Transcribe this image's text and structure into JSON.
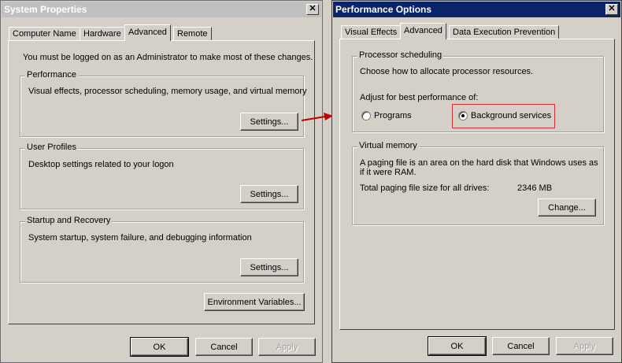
{
  "system_properties": {
    "title": "System Properties",
    "tabs": [
      "Computer Name",
      "Hardware",
      "Advanced",
      "Remote"
    ],
    "admin_note": "You must be logged on as an Administrator to make most of these changes.",
    "performance": {
      "legend": "Performance",
      "description": "Visual effects, processor scheduling, memory usage, and virtual memory",
      "settings_label": "Settings..."
    },
    "user_profiles": {
      "legend": "User Profiles",
      "description": "Desktop settings related to your logon",
      "settings_label": "Settings..."
    },
    "startup_recovery": {
      "legend": "Startup and Recovery",
      "description": "System startup, system failure, and debugging information",
      "settings_label": "Settings..."
    },
    "env_vars_label": "Environment Variables...",
    "ok_label": "OK",
    "cancel_label": "Cancel",
    "apply_label": "Apply"
  },
  "performance_options": {
    "title": "Performance Options",
    "tabs": [
      "Visual Effects",
      "Advanced",
      "Data Execution Prevention"
    ],
    "processor_scheduling": {
      "legend": "Processor scheduling",
      "description": "Choose how to allocate processor resources.",
      "adjust_label": "Adjust for best performance of:",
      "option_programs": "Programs",
      "option_background": "Background services"
    },
    "virtual_memory": {
      "legend": "Virtual memory",
      "description_line1": "A paging file is an area on the hard disk that Windows uses as",
      "description_line2": "if it were RAM.",
      "total_label": "Total paging file size for all drives:",
      "total_value": "2346 MB",
      "change_label": "Change..."
    },
    "ok_label": "OK",
    "cancel_label": "Cancel",
    "apply_label": "Apply"
  },
  "colors": {
    "active_title": "#0a246a",
    "highlight_box": "#d03030",
    "arrow": "#c00000"
  }
}
